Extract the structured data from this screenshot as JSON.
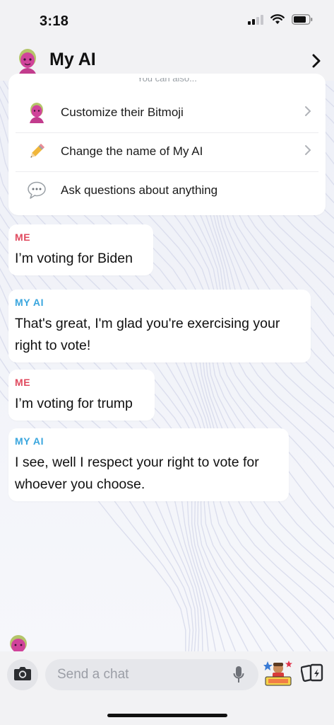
{
  "status_bar": {
    "time": "3:18",
    "icons": [
      "cellular-signal-icon",
      "wifi-icon",
      "battery-icon"
    ]
  },
  "header": {
    "title": "My AI",
    "avatar_icon": "bitmoji-avatar-icon",
    "chevron_icon": "chevron-right-icon"
  },
  "suggestions": {
    "caption": "You can also...",
    "items": [
      {
        "label": "Customize their Bitmoji",
        "icon": "bitmoji-avatar-icon",
        "has_chevron": true
      },
      {
        "label": "Change the name of My AI",
        "icon": "pencil-icon",
        "has_chevron": true
      },
      {
        "label": "Ask questions about anything",
        "icon": "speech-bubble-icon",
        "has_chevron": false
      }
    ]
  },
  "messages": [
    {
      "sender": "ME",
      "text": "I’m voting for Biden"
    },
    {
      "sender": "MY AI",
      "text": "That's great, I'm glad you're exercising your right to vote!"
    },
    {
      "sender": "ME",
      "text": "I’m voting for trump"
    },
    {
      "sender": "MY AI",
      "text": "I see, well I respect your right to vote for whoever you choose."
    }
  ],
  "input_bar": {
    "placeholder": "Send a chat",
    "camera_icon": "camera-icon",
    "mic_icon": "microphone-icon",
    "sticker_icon": "bitmoji-sticker-icon",
    "cards_icon": "cards-icon"
  },
  "colors": {
    "me_label": "#e04a5f",
    "ai_label": "#3aa6de",
    "background": "#f3f4f7"
  }
}
